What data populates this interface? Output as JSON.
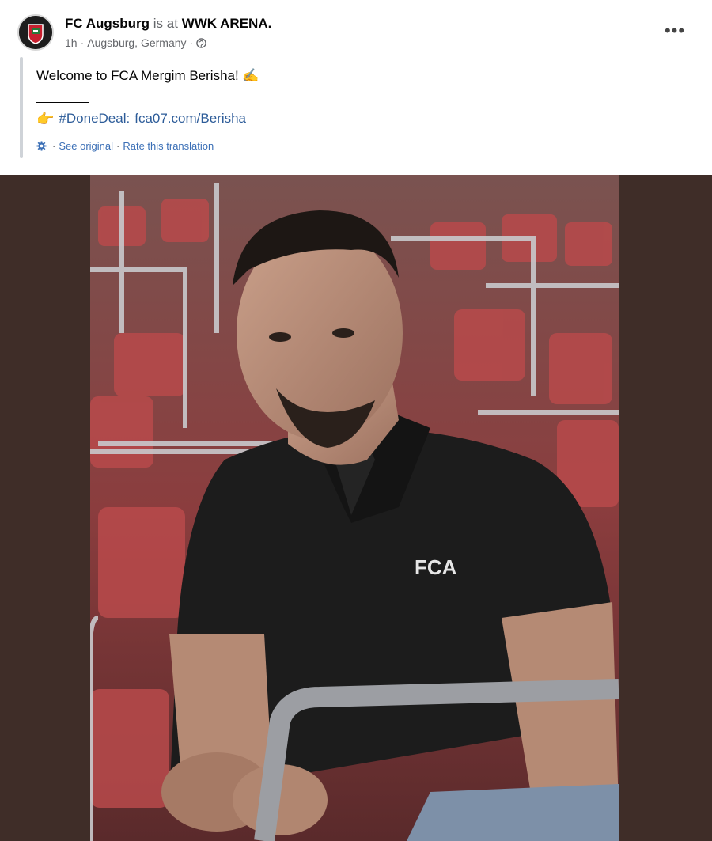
{
  "post": {
    "author": "FC Augsburg",
    "checkin_prefix": "is at",
    "location_name": "WWK ARENA.",
    "time": "1h",
    "place": "Augsburg, Germany",
    "meta_separator": "·",
    "more_label": "•••",
    "text": "Welcome to FCA Mergim Berisha! ✍",
    "divider": "________",
    "pointing_emoji": "👉",
    "hashtag": "#DoneDeal",
    "colon": ":",
    "link": "fca07.com/Berisha",
    "translation": {
      "see_original": "See original",
      "separator": "·",
      "rate": "Rate this translation"
    },
    "photo": {
      "shirt_logo": "FCA",
      "description_colors": {
        "seats": "#b8474a",
        "background": "#3f2d28",
        "shirt": "#1c1c1c"
      }
    }
  },
  "colors": {
    "link": "#2d5c99",
    "muted": "#65676b",
    "accent": "#3b6fb6"
  },
  "icons": {
    "avatar": "fc-augsburg-logo",
    "globe": "globe-icon",
    "more": "more-options-icon",
    "gear": "gear-icon",
    "pointing": "pointing-hand-icon"
  }
}
